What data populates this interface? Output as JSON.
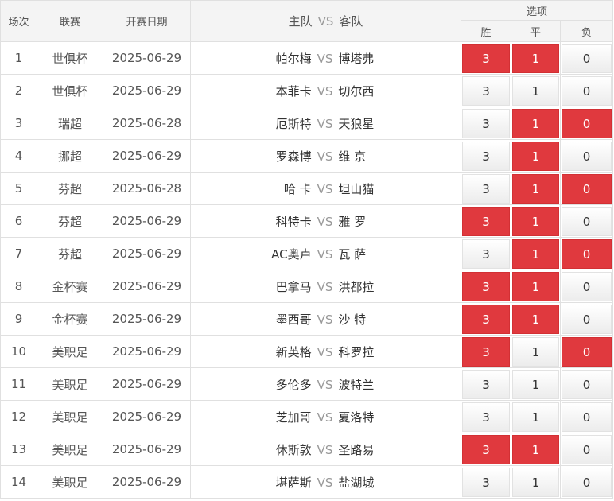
{
  "header": {
    "seq": "场次",
    "league": "联赛",
    "date": "开赛日期",
    "home": "主队",
    "vs": "VS",
    "away": "客队",
    "options": "选项",
    "win": "胜",
    "draw": "平",
    "lose": "负"
  },
  "colors": {
    "selected": "#e0393e",
    "header_bg": "#f4f4f4",
    "border": "#e0e0e0"
  },
  "rows": [
    {
      "seq": "1",
      "league": "世俱杯",
      "date": "2025-06-29",
      "home": "帕尔梅",
      "away": "博塔弗",
      "win": "3",
      "draw": "1",
      "lose": "0",
      "sel": [
        true,
        true,
        false
      ]
    },
    {
      "seq": "2",
      "league": "世俱杯",
      "date": "2025-06-29",
      "home": "本菲卡",
      "away": "切尔西",
      "win": "3",
      "draw": "1",
      "lose": "0",
      "sel": [
        false,
        false,
        false
      ]
    },
    {
      "seq": "3",
      "league": "瑞超",
      "date": "2025-06-28",
      "home": "厄斯特",
      "away": "天狼星",
      "win": "3",
      "draw": "1",
      "lose": "0",
      "sel": [
        false,
        true,
        true
      ]
    },
    {
      "seq": "4",
      "league": "挪超",
      "date": "2025-06-29",
      "home": "罗森博",
      "away": "维 京",
      "win": "3",
      "draw": "1",
      "lose": "0",
      "sel": [
        false,
        true,
        false
      ]
    },
    {
      "seq": "5",
      "league": "芬超",
      "date": "2025-06-28",
      "home": "哈 卡",
      "away": "坦山猫",
      "win": "3",
      "draw": "1",
      "lose": "0",
      "sel": [
        false,
        true,
        true
      ]
    },
    {
      "seq": "6",
      "league": "芬超",
      "date": "2025-06-29",
      "home": "科特卡",
      "away": "雅 罗",
      "win": "3",
      "draw": "1",
      "lose": "0",
      "sel": [
        true,
        true,
        false
      ]
    },
    {
      "seq": "7",
      "league": "芬超",
      "date": "2025-06-29",
      "home": "AC奥卢",
      "away": "瓦 萨",
      "win": "3",
      "draw": "1",
      "lose": "0",
      "sel": [
        false,
        true,
        true
      ]
    },
    {
      "seq": "8",
      "league": "金杯赛",
      "date": "2025-06-29",
      "home": "巴拿马",
      "away": "洪都拉",
      "win": "3",
      "draw": "1",
      "lose": "0",
      "sel": [
        true,
        true,
        false
      ]
    },
    {
      "seq": "9",
      "league": "金杯赛",
      "date": "2025-06-29",
      "home": "墨西哥",
      "away": "沙 特",
      "win": "3",
      "draw": "1",
      "lose": "0",
      "sel": [
        true,
        true,
        false
      ]
    },
    {
      "seq": "10",
      "league": "美职足",
      "date": "2025-06-29",
      "home": "新英格",
      "away": "科罗拉",
      "win": "3",
      "draw": "1",
      "lose": "0",
      "sel": [
        true,
        false,
        true
      ]
    },
    {
      "seq": "11",
      "league": "美职足",
      "date": "2025-06-29",
      "home": "多伦多",
      "away": "波特兰",
      "win": "3",
      "draw": "1",
      "lose": "0",
      "sel": [
        false,
        false,
        false
      ]
    },
    {
      "seq": "12",
      "league": "美职足",
      "date": "2025-06-29",
      "home": "芝加哥",
      "away": "夏洛特",
      "win": "3",
      "draw": "1",
      "lose": "0",
      "sel": [
        false,
        false,
        false
      ]
    },
    {
      "seq": "13",
      "league": "美职足",
      "date": "2025-06-29",
      "home": "休斯敦",
      "away": "圣路易",
      "win": "3",
      "draw": "1",
      "lose": "0",
      "sel": [
        true,
        true,
        false
      ]
    },
    {
      "seq": "14",
      "league": "美职足",
      "date": "2025-06-29",
      "home": "堪萨斯",
      "away": "盐湖城",
      "win": "3",
      "draw": "1",
      "lose": "0",
      "sel": [
        false,
        false,
        false
      ]
    }
  ]
}
